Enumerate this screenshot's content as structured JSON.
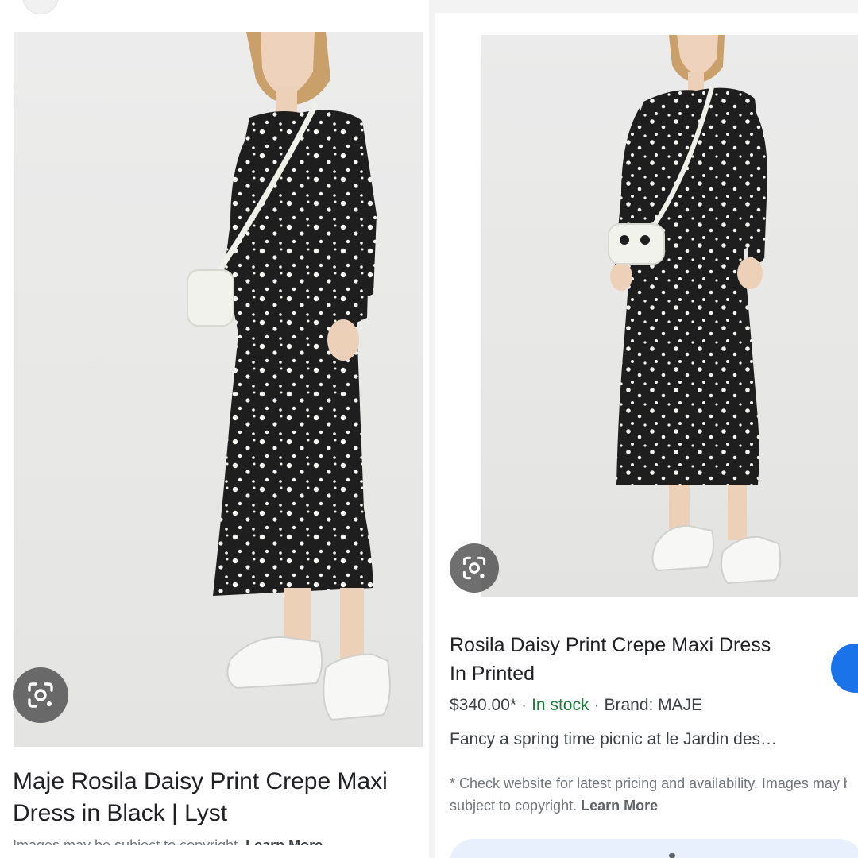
{
  "left": {
    "title": "Maje Rosila Daisy Print Crepe Maxi Dress in Black | Lyst",
    "cut_text": "Images may be subject to copyright.",
    "cut_link": "Learn More"
  },
  "right": {
    "title": "Rosila Daisy Print Crepe Maxi Dress In Printed",
    "price": "$340.00*",
    "stock": "In stock",
    "brand": "Brand: MAJE",
    "description": "Fancy a spring time picnic at le Jardin des…",
    "disclaimer_line1": "* Check website for latest pricing and availability. Images may be",
    "disclaimer_line2": "subject to copyright.",
    "learn_more": "Learn More"
  },
  "colors": {
    "accent_blue": "#1a73e8",
    "stock_green": "#188038",
    "dress": "#1e1e1e",
    "daisy": "#f4f4f0"
  },
  "icons": [
    "google-lens-icon"
  ]
}
